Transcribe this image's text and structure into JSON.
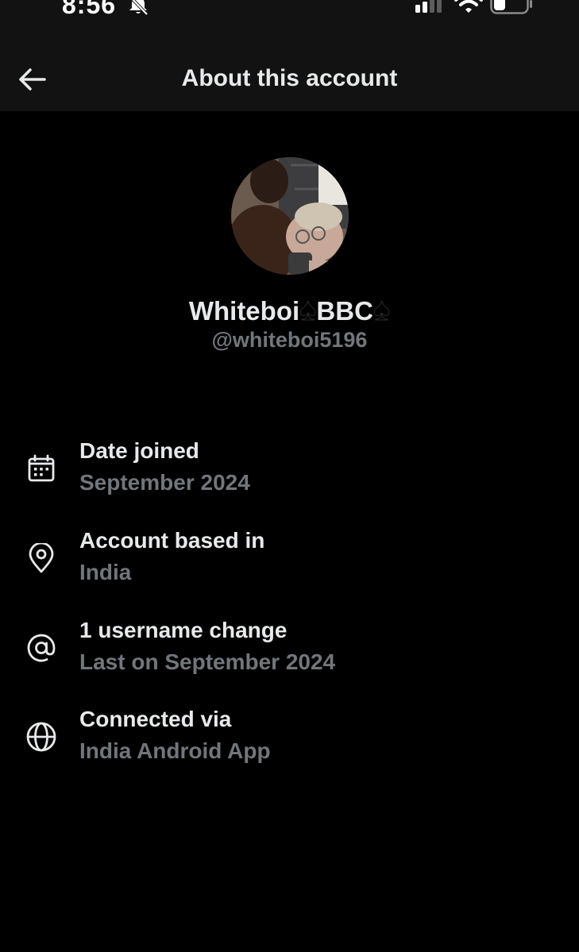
{
  "status_bar": {
    "time": "8:56"
  },
  "header": {
    "title": "About this account"
  },
  "profile": {
    "display_name_part1": "Whiteboi",
    "spade_1": "♠",
    "display_name_part2": "BBC",
    "spade_2": "♠",
    "handle": "@whiteboi5196"
  },
  "info": [
    {
      "icon": "calendar-icon",
      "label": "Date joined",
      "value": "September 2024"
    },
    {
      "icon": "location-pin-icon",
      "label": "Account based in",
      "value": "India"
    },
    {
      "icon": "at-sign-icon",
      "label": "1 username change",
      "value": "Last on September 2024"
    },
    {
      "icon": "globe-icon",
      "label": "Connected via",
      "value": "India Android App"
    }
  ],
  "colors": {
    "background": "#000000",
    "header_background": "#121212",
    "primary_text": "#e7e9ea",
    "secondary_text": "#71767b"
  }
}
